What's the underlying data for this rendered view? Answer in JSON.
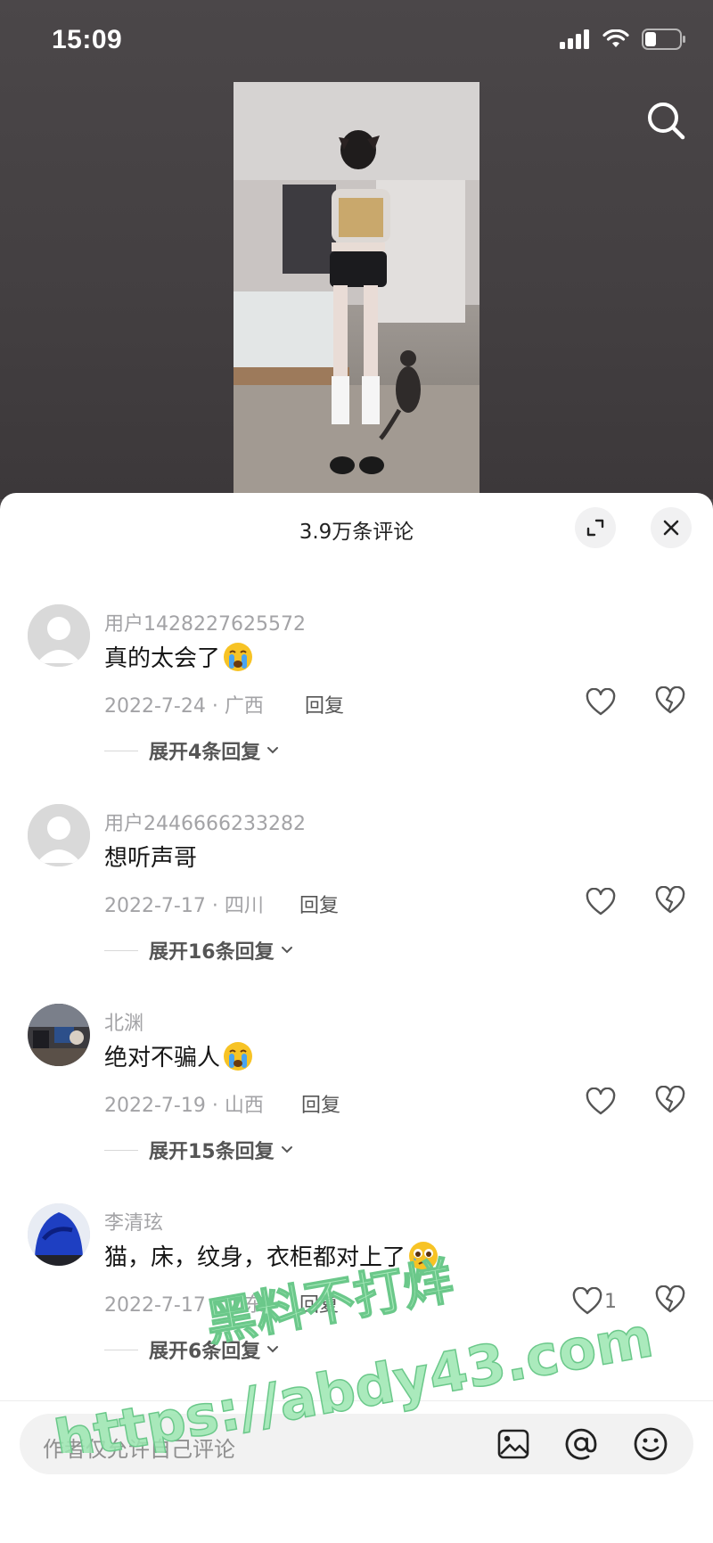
{
  "status_bar": {
    "time": "15:09"
  },
  "sheet": {
    "title": "3.9万条评论"
  },
  "comments": [
    {
      "user": "用户1428227625572",
      "text": "真的太会了",
      "emoji": "crying-face",
      "meta": "2022-7-24 · 广西",
      "reply": "回复",
      "expand": "展开4条回复",
      "likes": ""
    },
    {
      "user": "用户2446666233282",
      "text": "想听声哥",
      "emoji": "",
      "meta": "2022-7-17 · 四川",
      "reply": "回复",
      "expand": "展开16条回复",
      "likes": ""
    },
    {
      "user": "北渊",
      "text": "绝对不骗人",
      "emoji": "crying-face",
      "meta": "2022-7-19 · 山西",
      "reply": "回复",
      "expand": "展开15条回复",
      "likes": ""
    },
    {
      "user": "李清玹",
      "text": "猫，床，纹身，衣柜都对上了",
      "emoji": "teary-face",
      "meta": "2022-7-17 · 山东",
      "reply": "回复",
      "expand": "展开6条回复",
      "likes": "1"
    }
  ],
  "input": {
    "placeholder": "作者仅允许自己评论"
  },
  "watermark": {
    "line1": "黑料不打烊",
    "line2": "https://abdy43.com"
  },
  "colors": {
    "accent_watermark": "#9be6b0",
    "sheet_bg": "#ffffff",
    "video_bg": "#4a4648"
  }
}
